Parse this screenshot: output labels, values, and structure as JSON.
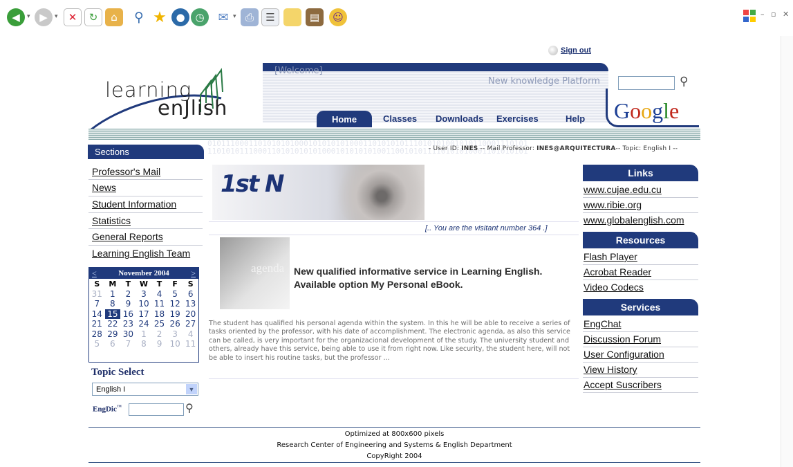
{
  "browser": {
    "toolbar_icons": [
      "back-icon",
      "forward-icon",
      "stop-icon",
      "refresh-icon",
      "home-icon",
      "search-icon",
      "favorites-icon",
      "media-icon",
      "history-icon",
      "mail-icon",
      "print-icon",
      "edit-icon",
      "discuss-icon",
      "research-icon",
      "messenger-icon"
    ]
  },
  "header": {
    "welcome": "[Welcome]",
    "sign_out": "Sign out",
    "logo_line1": "learning",
    "logo_line2": "enJlish",
    "tagline": "New knowledge Platform",
    "google": "Google",
    "nav": [
      "Home",
      "Classes",
      "Downloads",
      "Exercises",
      "Help"
    ]
  },
  "sidebar": {
    "title": "Sections",
    "items": [
      "Professor's Mail",
      "News",
      "Student Information",
      "Statistics",
      "General Reports",
      "Learning English Team"
    ],
    "calendar": {
      "prev": "<",
      "next": ">",
      "month": "November 2004",
      "dow": [
        "S",
        "M",
        "T",
        "W",
        "T",
        "F",
        "S"
      ],
      "weeks": [
        [
          "31",
          "1",
          "2",
          "3",
          "4",
          "5",
          "6"
        ],
        [
          "7",
          "8",
          "9",
          "10",
          "11",
          "12",
          "13"
        ],
        [
          "14",
          "15",
          "16",
          "17",
          "18",
          "19",
          "20"
        ],
        [
          "21",
          "22",
          "23",
          "24",
          "25",
          "26",
          "27"
        ],
        [
          "28",
          "29",
          "30",
          "1",
          "2",
          "3",
          "4"
        ],
        [
          "5",
          "6",
          "7",
          "8",
          "9",
          "10",
          "11"
        ]
      ],
      "today": "15"
    },
    "topic_title": "Topic Select",
    "topic_value": "English I",
    "engdic": "EngDic",
    "engdic_tm": "™"
  },
  "main": {
    "userinfo_prefix": "- User ID: ",
    "user_id": "INES",
    "userinfo_mid": " -- Mail Professor: ",
    "mail": "INES@ARQUITECTURA",
    "userinfo_topic": "-- Topic: ",
    "topic": "English I",
    "userinfo_end": " --",
    "banner_text": "1st N",
    "visit": "[.. You are the visitant number 364 .]",
    "agenda_label": "agenda",
    "headline_1": "New qualified informative service in Learning English.",
    "headline_2": "Available option My Personal eBook.",
    "body": "The student has qualified his personal agenda within the system. In this he will be able to receive a series of tasks oriented by the professor, with his date of accomplishment. The electronic agenda, as also this service can be called, is very important for the organizacional development of the study. The university student and others, already have this service, being able to use it from right now. Like security, the student here, will not be able to insert his routine tasks, but the professor ..."
  },
  "right": {
    "links_title": "Links",
    "links": [
      "www.cujae.edu.cu",
      "www.ribie.org",
      "www.globalenglish.com"
    ],
    "resources_title": "Resources",
    "resources": [
      "Flash Player",
      "Acrobat Reader",
      "Video Codecs"
    ],
    "services_title": "Services",
    "services": [
      "EngChat",
      "Discussion Forum",
      "User Configuration",
      "View History",
      "Accept Suscribers"
    ]
  },
  "footer": {
    "line1": "Optimized at 800x600 pixels",
    "line2": "Research Center of Engineering and Systems & English Department",
    "line3": "CopyRight 2004"
  },
  "colors": {
    "navy": "#203a7c",
    "stripe": "#7fa3a3"
  }
}
